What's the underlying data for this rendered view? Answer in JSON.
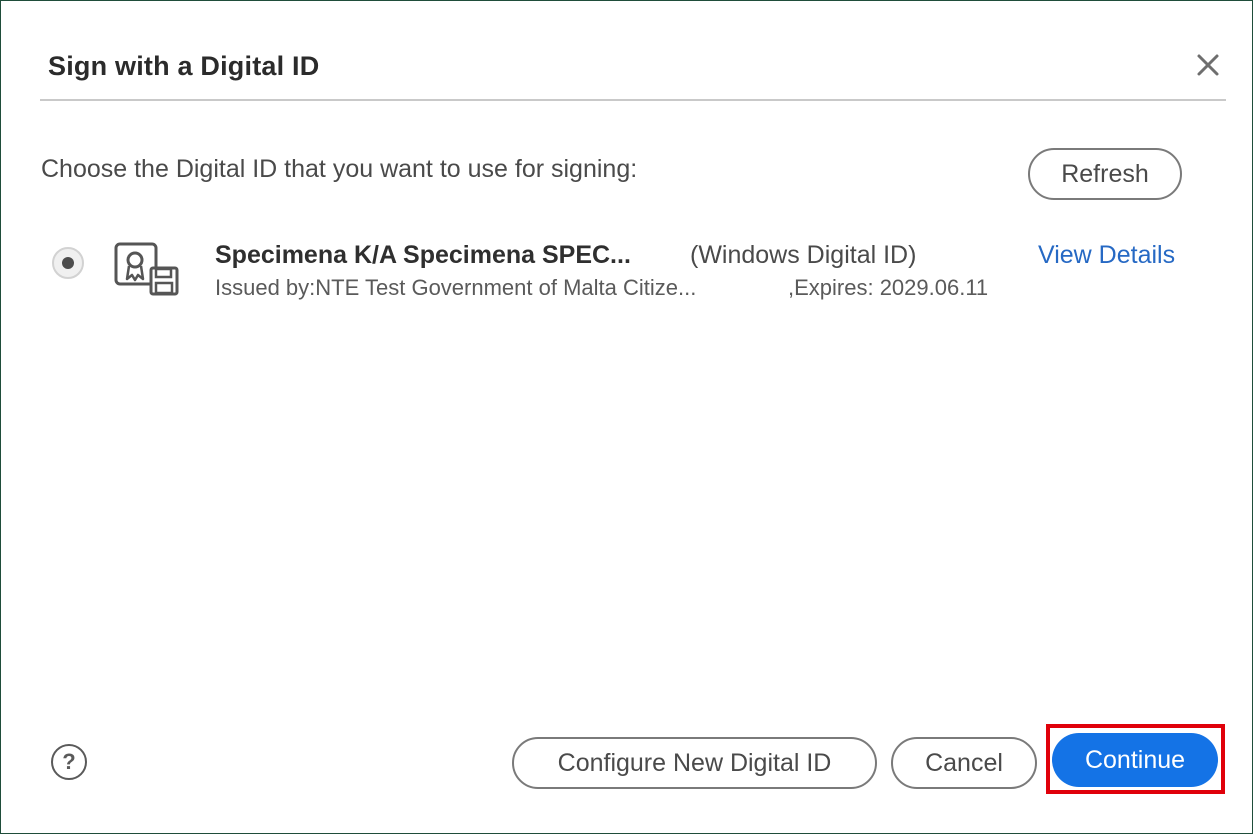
{
  "dialog": {
    "title": "Sign with a Digital ID",
    "close_icon": "close-icon",
    "prompt": "Choose the Digital ID that you want to use for signing:"
  },
  "toolbar": {
    "refresh_label": "Refresh"
  },
  "digital_ids": [
    {
      "selected": true,
      "icon": "certificate-icon",
      "name": "Specimena K/A Specimena SPEC...",
      "type": "(Windows Digital ID)",
      "issued_by": "Issued by:NTE Test Government of Malta Citize...",
      "expires": ",Expires: 2029.06.11",
      "details_label": "View Details"
    }
  ],
  "footer": {
    "help_label": "?",
    "configure_label": "Configure New Digital ID",
    "cancel_label": "Cancel",
    "continue_label": "Continue"
  },
  "colors": {
    "accent": "#1473e6",
    "link": "#2669c4",
    "highlight": "#e0000a"
  }
}
